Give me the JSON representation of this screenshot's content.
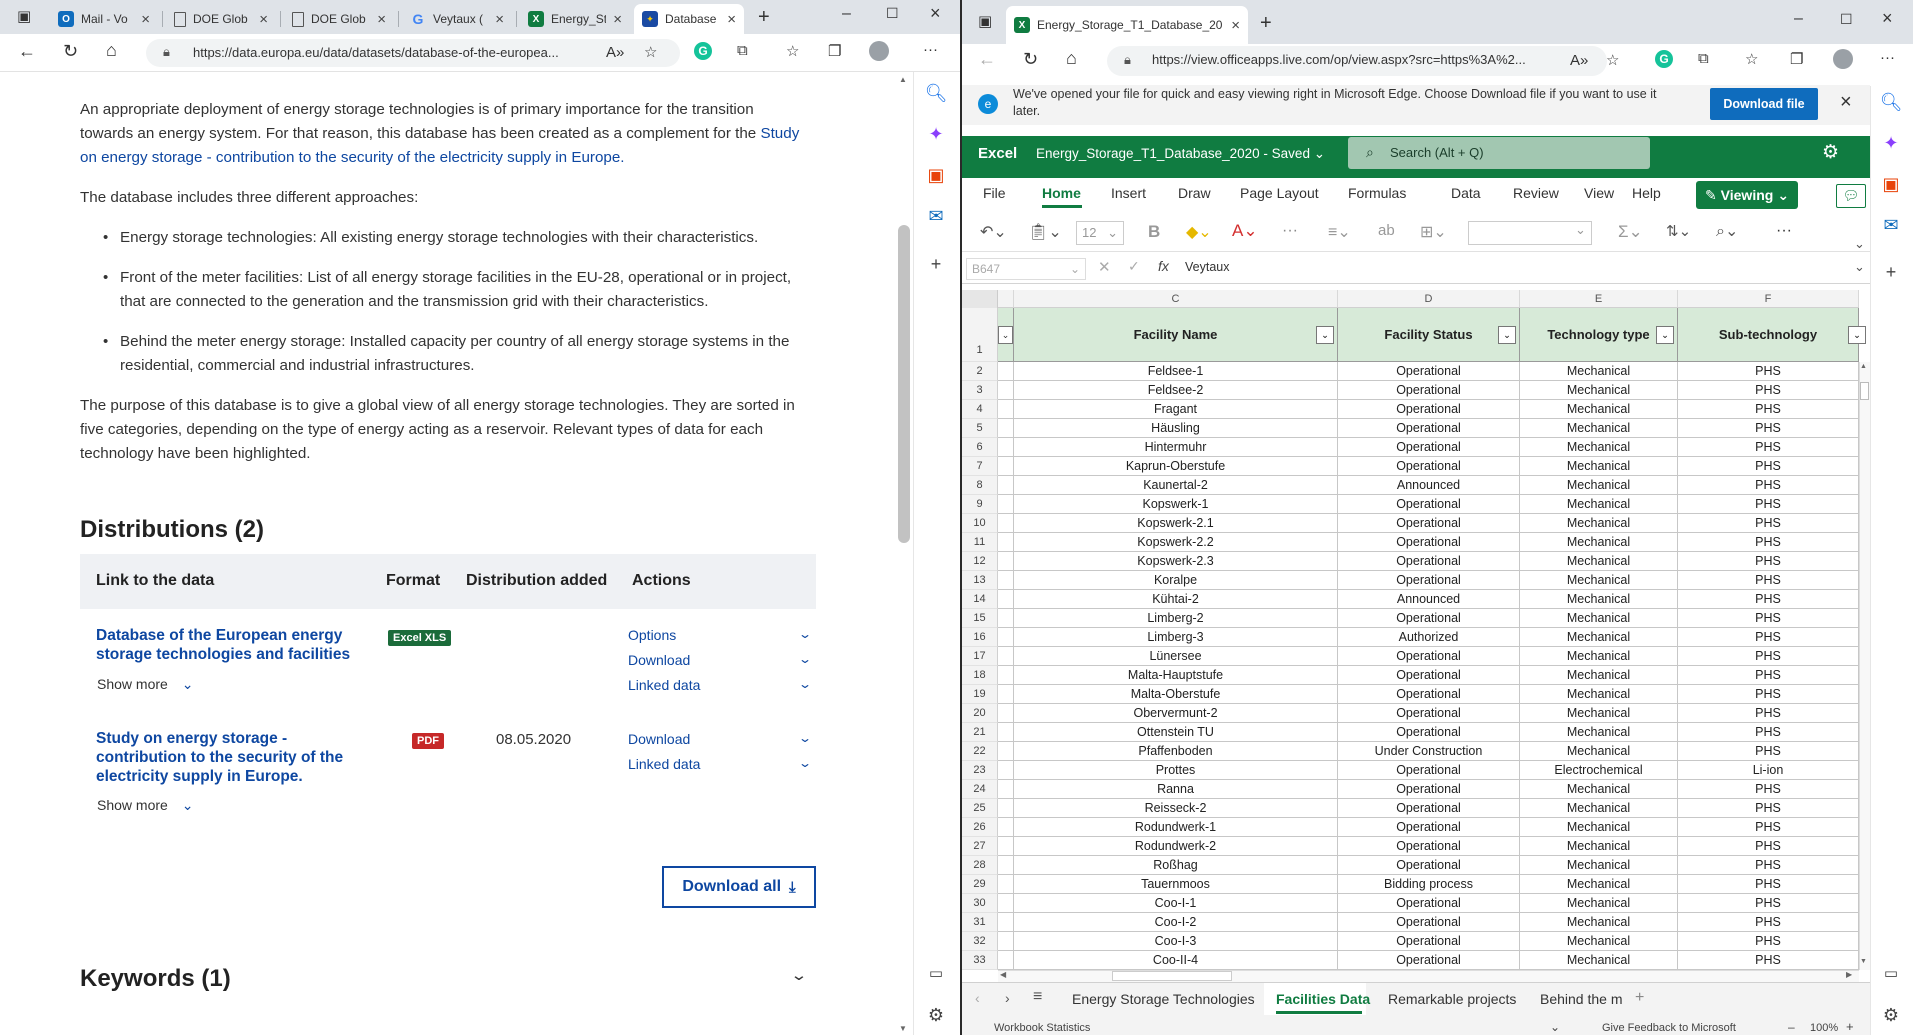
{
  "left_browser": {
    "tabs": [
      {
        "label": "Mail - Vo",
        "icon": "outlook-icon",
        "color": "#0f6cbd"
      },
      {
        "label": "DOE Glob",
        "icon": "page-icon"
      },
      {
        "label": "DOE Glob",
        "icon": "page-icon"
      },
      {
        "label": "Veytaux (",
        "icon": "google-icon"
      },
      {
        "label": "Energy_St",
        "icon": "excel-icon",
        "color": "#107c41"
      },
      {
        "label": "Database",
        "icon": "eu-flag-icon",
        "color": "#1a4aa3",
        "active": true
      }
    ],
    "url": "https://data.europa.eu/data/datasets/database-of-the-europea...",
    "intro": {
      "p1_text": "An appropriate deployment of energy storage technologies is of primary importance for the transition towards an energy system. For that reason, this database has been created as a complement for the",
      "p1_link": "Study on energy storage - contribution to the security of the electricity supply in Europe.",
      "p2": "The database includes three different approaches:",
      "bullets": [
        "Energy storage technologies: All existing energy storage technologies with their characteristics.",
        "Front of the meter facilities: List of all energy storage facilities in the EU-28, operational or in project, that are connected to the generation and the transmission grid with their characteristics.",
        "Behind the meter energy storage: Installed capacity per country of all energy storage systems in the residential, commercial and industrial infrastructures."
      ],
      "p3": "The purpose of this database is to give a global view of all energy storage technologies. They are sorted in five categories, depending on the type of energy acting as a reservoir. Relevant types of data for each technology have been highlighted."
    },
    "distributions": {
      "heading": "Distributions (2)",
      "headers": [
        "Link to the data",
        "Format",
        "Distribution added",
        "Actions"
      ],
      "items": [
        {
          "title": "Database of the European energy storage technologies and facilities",
          "format": "Excel XLS",
          "format_color": "#1b6b3a",
          "date": "",
          "show_more": "Show more",
          "actions": [
            "Options",
            "Download",
            "Linked data"
          ]
        },
        {
          "title": "Study on energy storage - contribution to the security of the electricity supply in Europe.",
          "format": "PDF",
          "format_color": "#c62828",
          "date": "08.05.2020",
          "show_more": "Show more",
          "actions": [
            "Download",
            "Linked data"
          ]
        }
      ],
      "download_all": "Download all"
    },
    "keywords": "Keywords (1)"
  },
  "right_browser": {
    "tab_title": "Energy_Storage_T1_Database_20",
    "url": "https://view.officeapps.live.com/op/view.aspx?src=https%3A%2...",
    "info_message": "We've opened your file for quick and easy viewing right in Microsoft Edge. Choose Download file if you want to use it later.",
    "download_file": "Download file",
    "excel": {
      "app": "Excel",
      "doc": "Energy_Storage_T1_Database_2020",
      "status": "Saved",
      "search_placeholder": "Search (Alt + Q)",
      "ribbon_tabs": [
        "File",
        "Home",
        "Insert",
        "Draw",
        "Page Layout",
        "Formulas",
        "Data",
        "Review",
        "View",
        "Help"
      ],
      "viewing": "Viewing",
      "font_size": "12",
      "cell_ref": "B647",
      "formula": "Veytaux",
      "columns": [
        "C",
        "D",
        "E",
        "F"
      ],
      "headers": [
        "Facility Name",
        "Facility Status",
        "Technology type",
        "Sub-technology"
      ],
      "rows": [
        [
          "2",
          "Feldsee-1",
          "Operational",
          "Mechanical",
          "PHS"
        ],
        [
          "3",
          "Feldsee-2",
          "Operational",
          "Mechanical",
          "PHS"
        ],
        [
          "4",
          "Fragant",
          "Operational",
          "Mechanical",
          "PHS"
        ],
        [
          "5",
          "Häusling",
          "Operational",
          "Mechanical",
          "PHS"
        ],
        [
          "6",
          "Hintermuhr",
          "Operational",
          "Mechanical",
          "PHS"
        ],
        [
          "7",
          "Kaprun-Oberstufe",
          "Operational",
          "Mechanical",
          "PHS"
        ],
        [
          "8",
          "Kaunertal-2",
          "Announced",
          "Mechanical",
          "PHS"
        ],
        [
          "9",
          "Kopswerk-1",
          "Operational",
          "Mechanical",
          "PHS"
        ],
        [
          "10",
          "Kopswerk-2.1",
          "Operational",
          "Mechanical",
          "PHS"
        ],
        [
          "11",
          "Kopswerk-2.2",
          "Operational",
          "Mechanical",
          "PHS"
        ],
        [
          "12",
          "Kopswerk-2.3",
          "Operational",
          "Mechanical",
          "PHS"
        ],
        [
          "13",
          "Koralpe",
          "Operational",
          "Mechanical",
          "PHS"
        ],
        [
          "14",
          "Kühtai-2",
          "Announced",
          "Mechanical",
          "PHS"
        ],
        [
          "15",
          "Limberg-2",
          "Operational",
          "Mechanical",
          "PHS"
        ],
        [
          "16",
          "Limberg-3",
          "Authorized",
          "Mechanical",
          "PHS"
        ],
        [
          "17",
          "Lünersee",
          "Operational",
          "Mechanical",
          "PHS"
        ],
        [
          "18",
          "Malta-Hauptstufe",
          "Operational",
          "Mechanical",
          "PHS"
        ],
        [
          "19",
          "Malta-Oberstufe",
          "Operational",
          "Mechanical",
          "PHS"
        ],
        [
          "20",
          "Obervermunt-2",
          "Operational",
          "Mechanical",
          "PHS"
        ],
        [
          "21",
          "Ottenstein TU",
          "Operational",
          "Mechanical",
          "PHS"
        ],
        [
          "22",
          "Pfaffenboden",
          "Under Construction",
          "Mechanical",
          "PHS"
        ],
        [
          "23",
          "Prottes",
          "Operational",
          "Electrochemical",
          "Li-ion"
        ],
        [
          "24",
          "Ranna",
          "Operational",
          "Mechanical",
          "PHS"
        ],
        [
          "25",
          "Reisseck-2",
          "Operational",
          "Mechanical",
          "PHS"
        ],
        [
          "26",
          "Rodundwerk-1",
          "Operational",
          "Mechanical",
          "PHS"
        ],
        [
          "27",
          "Rodundwerk-2",
          "Operational",
          "Mechanical",
          "PHS"
        ],
        [
          "28",
          "Roßhag",
          "Operational",
          "Mechanical",
          "PHS"
        ],
        [
          "29",
          "Tauernmoos",
          "Bidding process",
          "Mechanical",
          "PHS"
        ],
        [
          "30",
          "Coo-I-1",
          "Operational",
          "Mechanical",
          "PHS"
        ],
        [
          "31",
          "Coo-I-2",
          "Operational",
          "Mechanical",
          "PHS"
        ],
        [
          "32",
          "Coo-I-3",
          "Operational",
          "Mechanical",
          "PHS"
        ],
        [
          "33",
          "Coo-II-4",
          "Operational",
          "Mechanical",
          "PHS"
        ]
      ],
      "sheets": [
        "Energy Storage Technologies",
        "Facilities Data",
        "Remarkable projects",
        "Behind the m"
      ],
      "status_left": "Workbook Statistics",
      "feedback": "Give Feedback to Microsoft",
      "zoom": "100%"
    }
  }
}
